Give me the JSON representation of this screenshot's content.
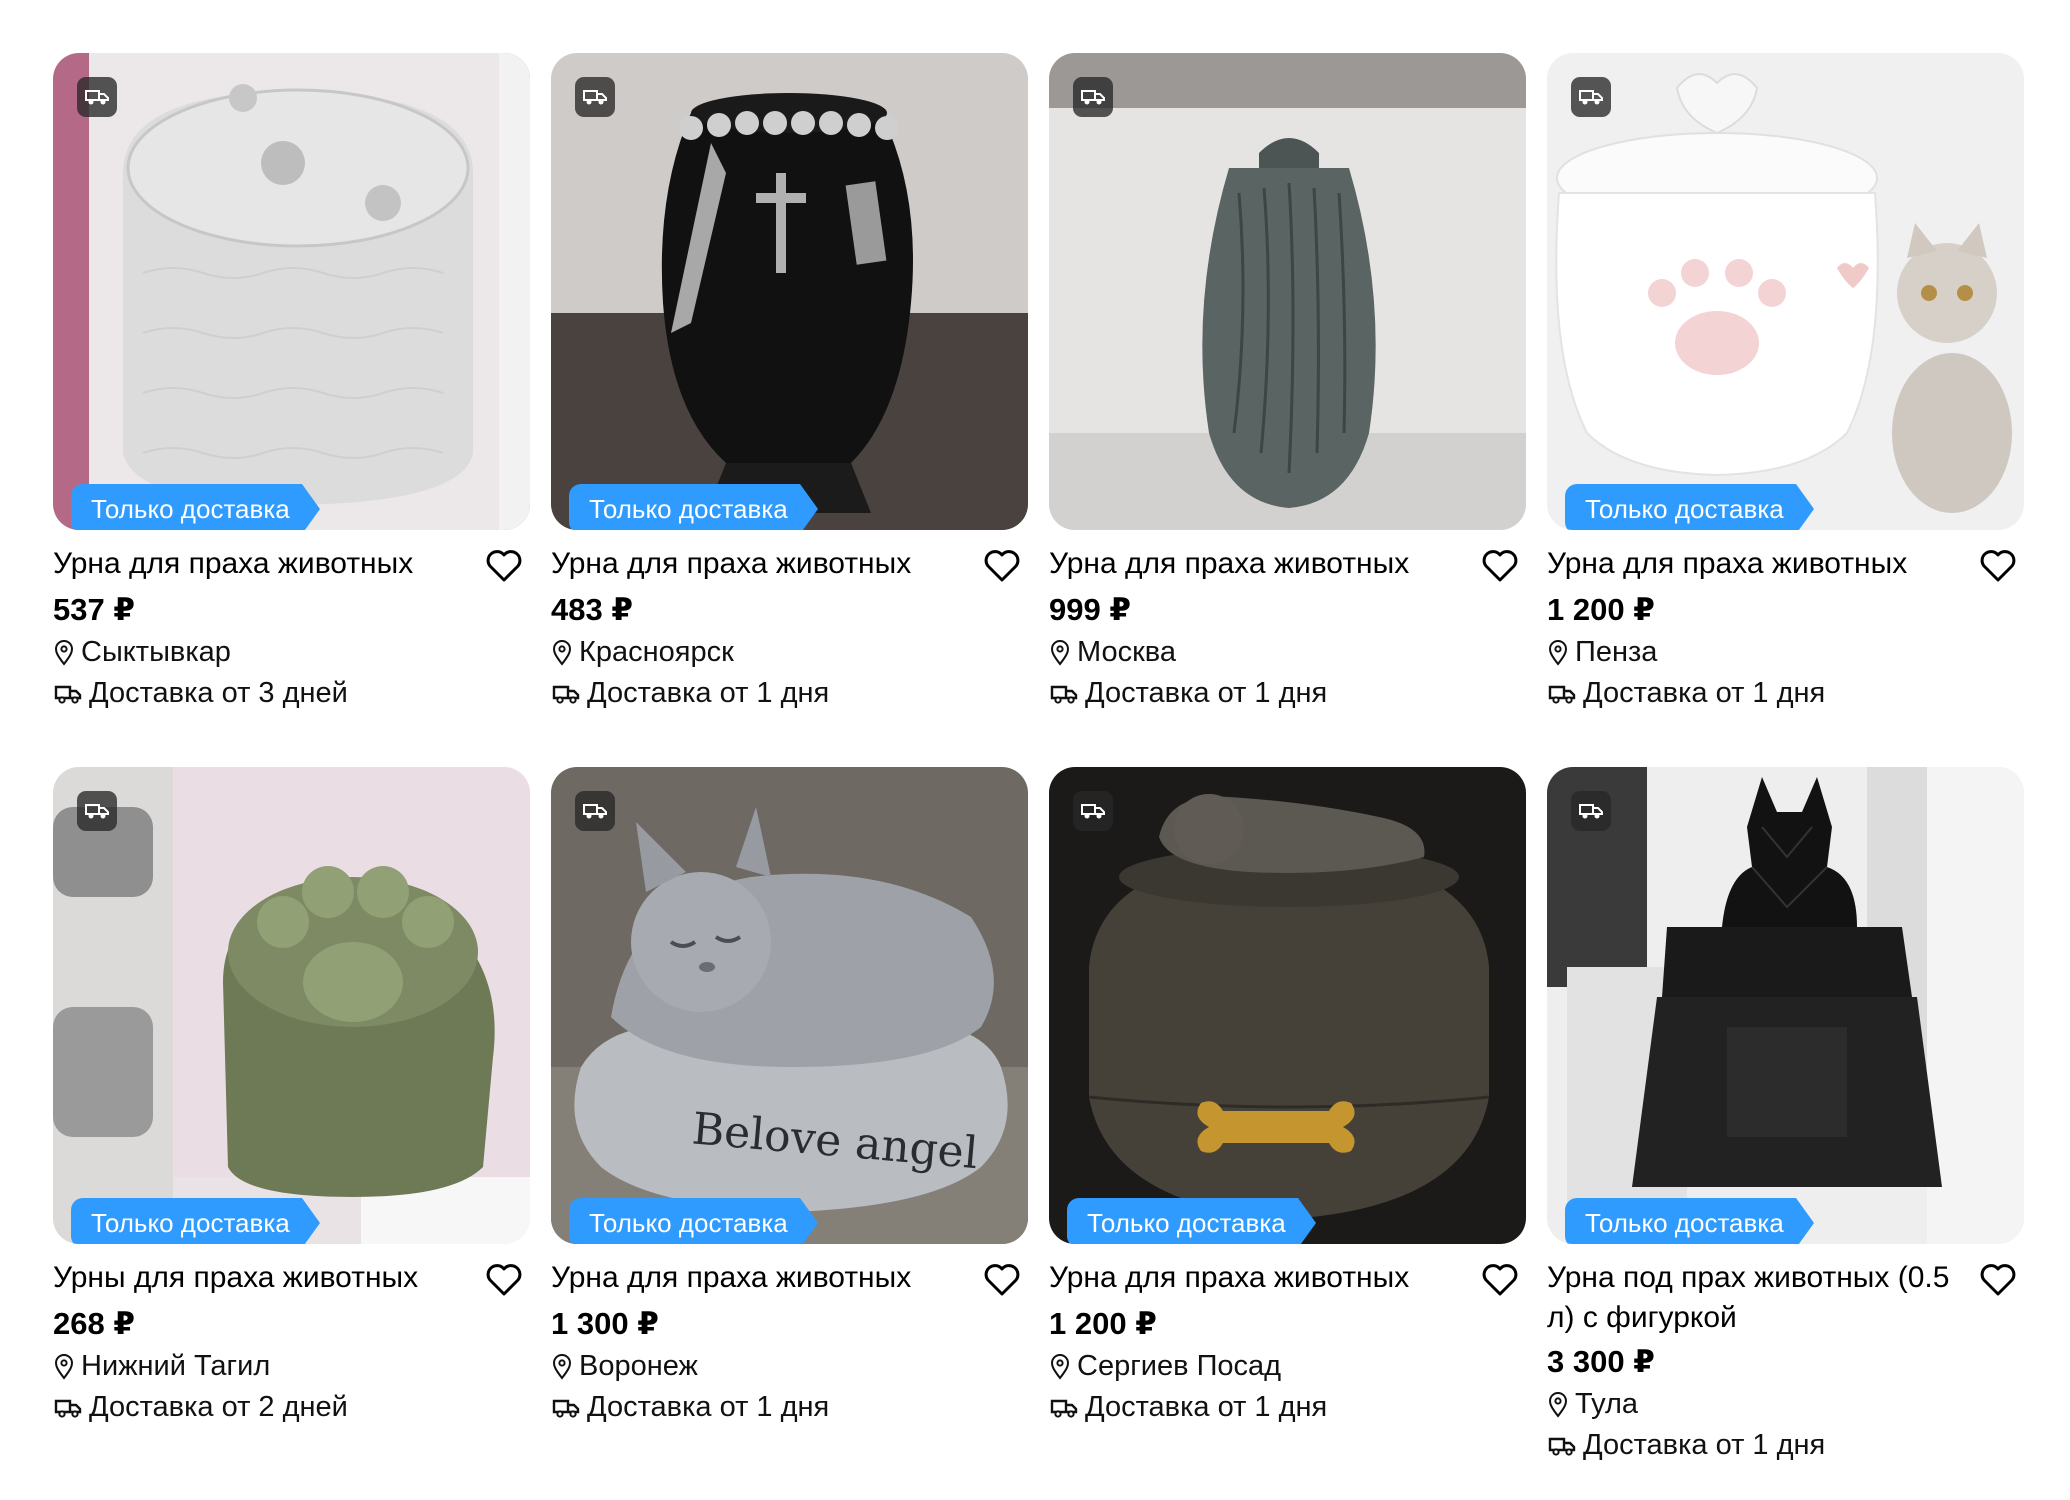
{
  "products": [
    {
      "title": "Урна для праха животных",
      "price": "537 ₽",
      "city": "Сыктывкар",
      "delivery": "Доставка от 3 дней",
      "tag": "Только доставка",
      "art": "white-textured-urn"
    },
    {
      "title": "Урна для праха животных",
      "price": "483 ₽",
      "city": "Красноярск",
      "delivery": "Доставка от 1 дня",
      "tag": "Только доставка",
      "art": "black-vase-urn"
    },
    {
      "title": "Урна для праха животных",
      "price": "999 ₽",
      "city": "Москва",
      "delivery": "Доставка от 1 дня",
      "tag": "",
      "art": "gray-capsule-urn"
    },
    {
      "title": "Урна для праха животных",
      "price": "1 200 ₽",
      "city": "Пенза",
      "delivery": "Доставка от 1 дня",
      "tag": "Только доставка",
      "art": "heart-lid-jar-with-cat"
    },
    {
      "title": "Урны для праха животных",
      "price": "268 ₽",
      "city": "Нижний Тагил",
      "delivery": "Доставка от 2 дней",
      "tag": "Только доставка",
      "art": "paw-boxes"
    },
    {
      "title": "Урна для праха животных",
      "price": "1 300 ₽",
      "city": "Воронеж",
      "delivery": "Доставка от 1 дня",
      "tag": "Только доставка",
      "art": "sleeping-cat-pillow",
      "engraving": "Belove angel"
    },
    {
      "title": "Урна для праха животных",
      "price": "1 200 ₽",
      "city": "Сергиев Посад",
      "delivery": "Доставка от 1 дня",
      "tag": "Только доставка",
      "art": "round-urn-sleeping-dog"
    },
    {
      "title": "Урна под прах животных (0.5 л) с фигуркой",
      "price": "3 300 ₽",
      "city": "Тула",
      "delivery": "Доставка от 1 дня",
      "tag": "Только доставка",
      "art": "black-pedestal-cat-figure"
    }
  ],
  "colors": {
    "tag_bg": "#2f9bff",
    "price": "#000000"
  }
}
